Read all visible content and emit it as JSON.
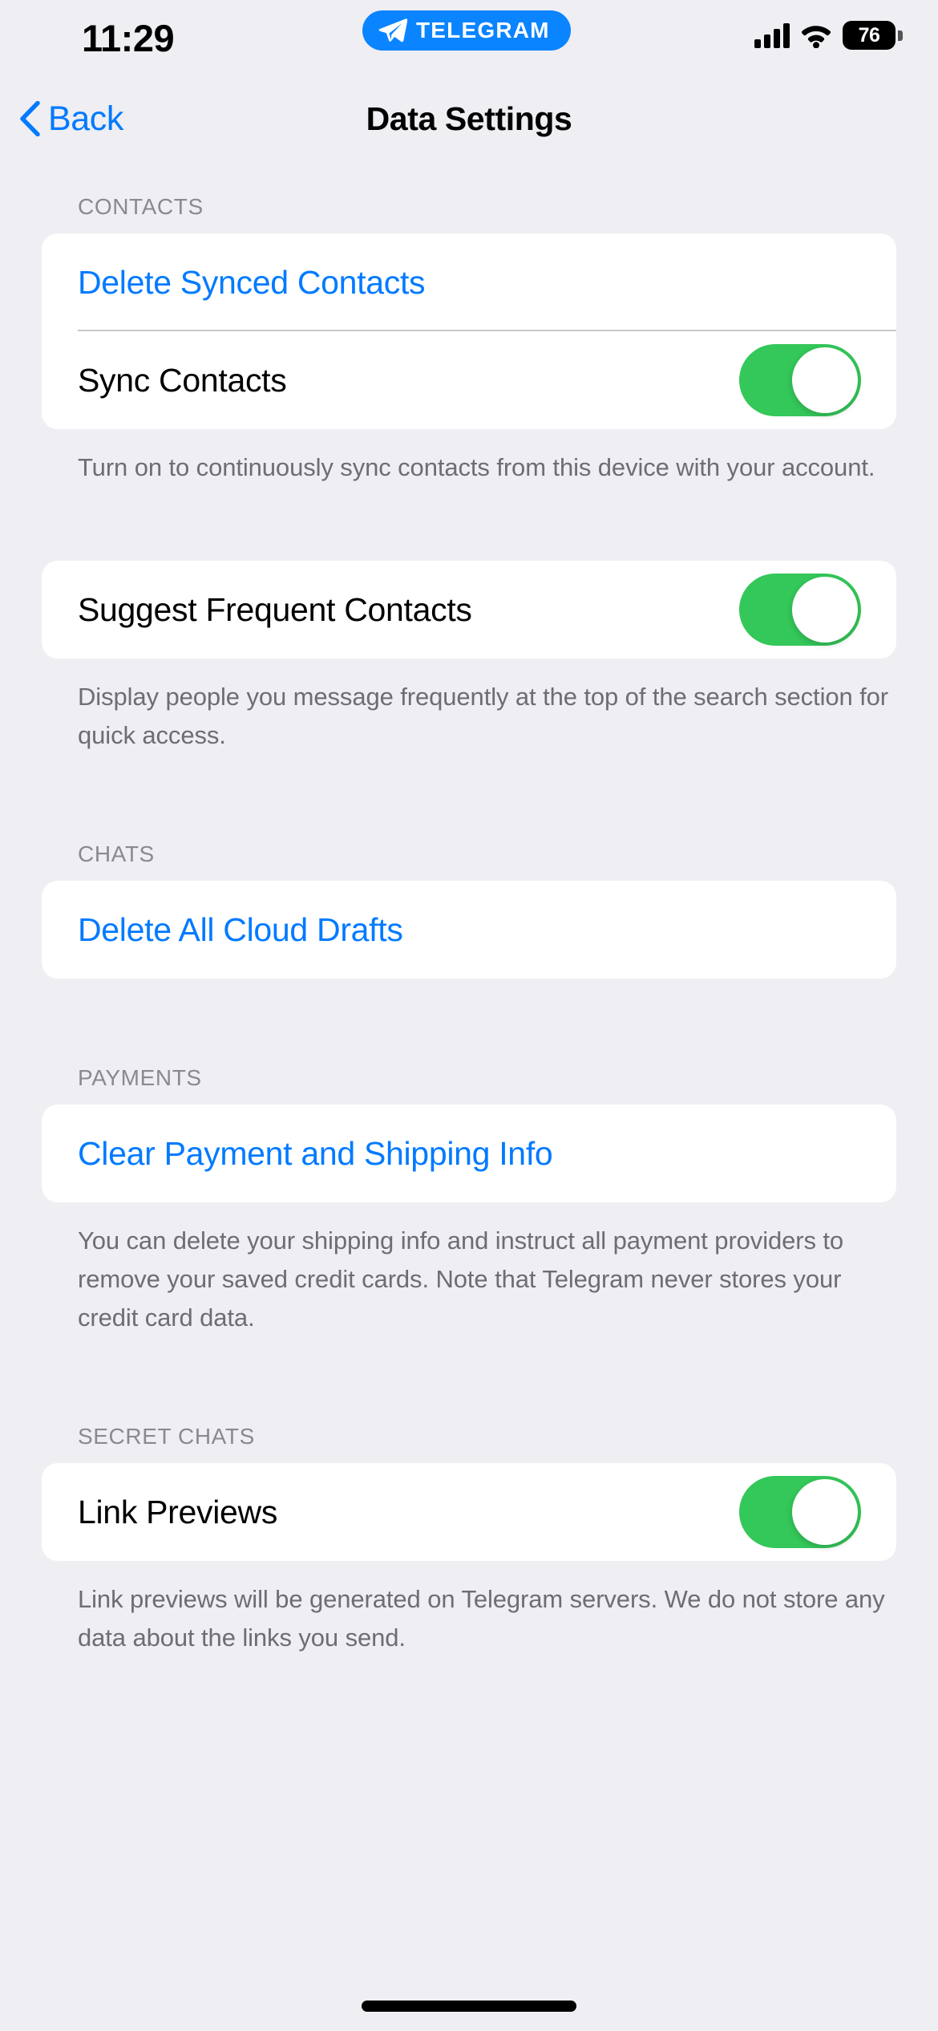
{
  "status_bar": {
    "time": "11:29",
    "dynamic_island": {
      "app_label": "TELEGRAM",
      "icon": "telegram-paper-plane-icon",
      "background_color": "#0A84FF"
    },
    "cellular_icon": "cellular-signal-icon",
    "wifi_icon": "wifi-icon",
    "battery_percent": "76"
  },
  "nav": {
    "back_label": "Back",
    "back_icon": "chevron-left-icon",
    "title": "Data Settings"
  },
  "colors": {
    "accent_blue": "#007AFF",
    "toggle_on_green": "#34C759",
    "page_background": "#EFEEF3",
    "card_background": "#FFFFFF",
    "secondary_text": "#6D6D72",
    "header_text": "#8A8A8E"
  },
  "sections": [
    {
      "header": "CONTACTS",
      "rows": [
        {
          "label": "Delete Synced Contacts",
          "type": "action"
        },
        {
          "label": "Sync Contacts",
          "type": "toggle",
          "value": "on"
        }
      ],
      "footer": "Turn on to continuously sync contacts from this device with your account."
    },
    {
      "header": "",
      "rows": [
        {
          "label": "Suggest Frequent Contacts",
          "type": "toggle",
          "value": "on"
        }
      ],
      "footer": "Display people you message frequently at the top of the search section for quick access."
    },
    {
      "header": "CHATS",
      "rows": [
        {
          "label": "Delete All Cloud Drafts",
          "type": "action"
        }
      ],
      "footer": ""
    },
    {
      "header": "PAYMENTS",
      "rows": [
        {
          "label": "Clear Payment and Shipping Info",
          "type": "action"
        }
      ],
      "footer": "You can delete your shipping info and instruct all payment providers to remove your saved credit cards. Note that Telegram never stores your credit card data."
    },
    {
      "header": "SECRET CHATS",
      "rows": [
        {
          "label": "Link Previews",
          "type": "toggle",
          "value": "on"
        }
      ],
      "footer": "Link previews will be generated on Telegram servers. We do not store any data about the links you send."
    }
  ]
}
